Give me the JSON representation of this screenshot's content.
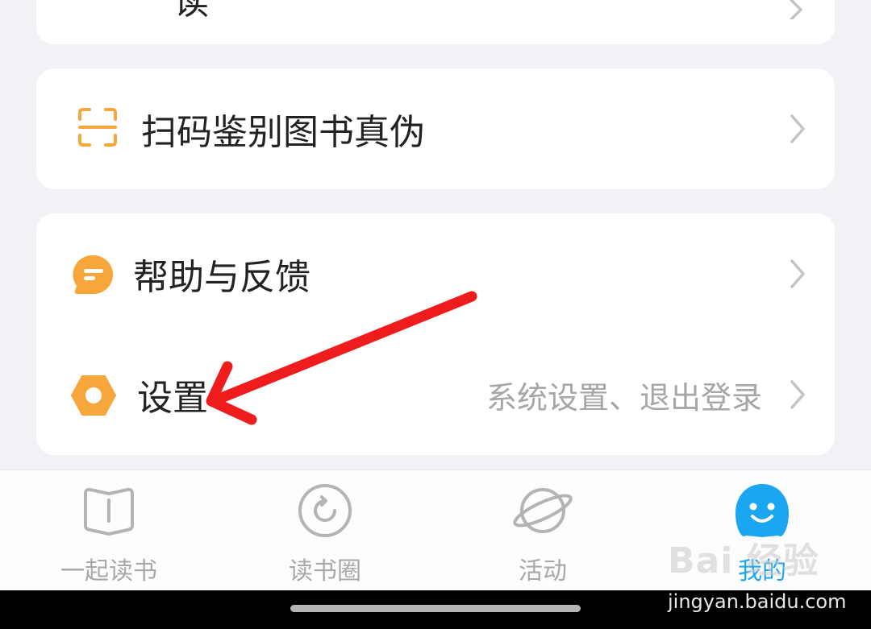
{
  "top_card": {
    "partial_label": "读",
    "partial_value": ""
  },
  "scan_card": {
    "label": "扫码鉴别图书真伪",
    "icon": "scan-icon"
  },
  "menu_card": {
    "items": [
      {
        "label": "帮助与反馈",
        "sub": "",
        "icon": "feedback-chat-icon"
      },
      {
        "label": "设置",
        "sub": "系统设置、退出登录",
        "icon": "settings-hexagon-icon"
      }
    ]
  },
  "tabbar": {
    "tabs": [
      {
        "label": "一起读书",
        "icon": "book-icon",
        "active": false
      },
      {
        "label": "读书圈",
        "icon": "circle-refresh-icon",
        "active": false
      },
      {
        "label": "活动",
        "icon": "planet-icon",
        "active": false
      },
      {
        "label": "我的",
        "icon": "smiley-face-icon",
        "active": true
      }
    ]
  },
  "watermark": {
    "logo": "Bai 经验",
    "url": "jingyan.baidu.com"
  },
  "colors": {
    "accent_orange": "#f7a63b",
    "active_tab_blue": "#1aa6f0",
    "annotation_red": "#ee1c1c",
    "page_bg": "#f1f2f6"
  }
}
